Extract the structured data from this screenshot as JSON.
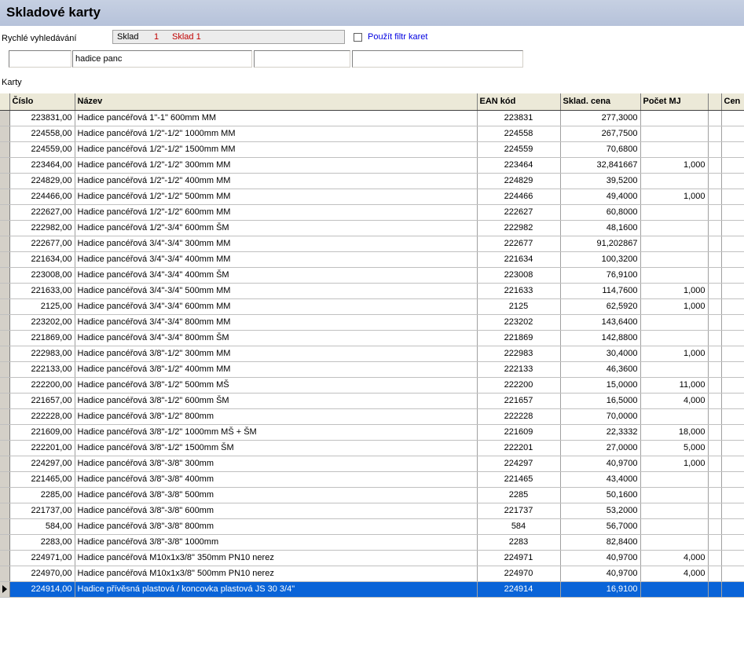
{
  "window": {
    "title": "Skladové karty"
  },
  "search": {
    "label": "Rychlé vyhledávání",
    "sklad_label": "Sklad",
    "sklad_number": "1",
    "sklad_name": "Sklad 1",
    "filter_label": "Použít filtr karet",
    "filter_checked": false,
    "field1_value": "",
    "field2_value": "hadice panc",
    "field3_value": "",
    "field4_value": ""
  },
  "grid": {
    "label": "Karty",
    "columns": [
      "Číslo",
      "Název",
      "EAN kód",
      "Sklad. cena",
      "Počet MJ",
      "",
      "Cen"
    ],
    "rows": [
      [
        "223831,00",
        "Hadice pancéřová 1\"-1\"  600mm MM",
        "223831",
        "277,3000",
        ""
      ],
      [
        "224558,00",
        "Hadice pancéřová 1/2\"-1/2\"  1000mm MM",
        "224558",
        "267,7500",
        ""
      ],
      [
        "224559,00",
        "Hadice pancéřová 1/2\"-1/2\"  1500mm MM",
        "224559",
        "70,6800",
        ""
      ],
      [
        "223464,00",
        "Hadice pancéřová 1/2\"-1/2\"  300mm MM",
        "223464",
        "32,841667",
        "1,000"
      ],
      [
        "224829,00",
        "Hadice pancéřová 1/2\"-1/2\"  400mm MM",
        "224829",
        "39,5200",
        ""
      ],
      [
        "224466,00",
        "Hadice pancéřová 1/2\"-1/2\"  500mm MM",
        "224466",
        "49,4000",
        "1,000"
      ],
      [
        "222627,00",
        "Hadice pancéřová 1/2\"-1/2\"  600mm MM",
        "222627",
        "60,8000",
        ""
      ],
      [
        "222982,00",
        "Hadice pancéřová 1/2\"-3/4\"  600mm ŠM",
        "222982",
        "48,1600",
        ""
      ],
      [
        "222677,00",
        "Hadice pancéřová 3/4\"-3/4\"  300mm MM",
        "222677",
        "91,202867",
        ""
      ],
      [
        "221634,00",
        "Hadice pancéřová 3/4\"-3/4\"  400mm MM",
        "221634",
        "100,3200",
        ""
      ],
      [
        "223008,00",
        "Hadice pancéřová 3/4\"-3/4\"  400mm ŠM",
        "223008",
        "76,9100",
        ""
      ],
      [
        "221633,00",
        "Hadice pancéřová 3/4\"-3/4\"  500mm MM",
        "221633",
        "114,7600",
        "1,000"
      ],
      [
        "2125,00",
        "Hadice pancéřová 3/4\"-3/4\"  600mm MM",
        "2125",
        "62,5920",
        "1,000"
      ],
      [
        "223202,00",
        "Hadice pancéřová 3/4\"-3/4\"  800mm MM",
        "223202",
        "143,6400",
        ""
      ],
      [
        "221869,00",
        "Hadice pancéřová 3/4\"-3/4\"  800mm ŠM",
        "221869",
        "142,8800",
        ""
      ],
      [
        "222983,00",
        "Hadice pancéřová 3/8\"-1/2\"  300mm MM",
        "222983",
        "30,4000",
        "1,000"
      ],
      [
        "222133,00",
        "Hadice pancéřová 3/8\"-1/2\"  400mm MM",
        "222133",
        "46,3600",
        ""
      ],
      [
        "222200,00",
        "Hadice pancéřová 3/8\"-1/2\"  500mm MŠ",
        "222200",
        "15,0000",
        "11,000"
      ],
      [
        "221657,00",
        "Hadice pancéřová 3/8\"-1/2\"  600mm ŠM",
        "221657",
        "16,5000",
        "4,000"
      ],
      [
        "222228,00",
        "Hadice pancéřová 3/8\"-1/2\"  800mm",
        "222228",
        "70,0000",
        ""
      ],
      [
        "221609,00",
        "Hadice pancéřová 3/8\"-1/2\" 1000mm MŠ + ŠM",
        "221609",
        "22,3332",
        "18,000"
      ],
      [
        "222201,00",
        "Hadice pancéřová 3/8\"-1/2\" 1500mm ŠM",
        "222201",
        "27,0000",
        "5,000"
      ],
      [
        "224297,00",
        "Hadice pancéřová 3/8\"-3/8\"  300mm",
        "224297",
        "40,9700",
        "1,000"
      ],
      [
        "221465,00",
        "Hadice pancéřová 3/8\"-3/8\"  400mm",
        "221465",
        "43,4000",
        ""
      ],
      [
        "2285,00",
        "Hadice pancéřová 3/8\"-3/8\"  500mm",
        "2285",
        "50,1600",
        ""
      ],
      [
        "221737,00",
        "Hadice pancéřová 3/8\"-3/8\"  600mm",
        "221737",
        "53,2000",
        ""
      ],
      [
        "584,00",
        "Hadice pancéřová 3/8\"-3/8\"  800mm",
        "584",
        "56,7000",
        ""
      ],
      [
        "2283,00",
        "Hadice pancéřová 3/8\"-3/8\" 1000mm",
        "2283",
        "82,8400",
        ""
      ],
      [
        "224971,00",
        "Hadice pancéřová M10x1x3/8\"  350mm PN10 nerez",
        "224971",
        "40,9700",
        "4,000"
      ],
      [
        "224970,00",
        "Hadice pancéřová M10x1x3/8\"  500mm PN10 nerez",
        "224970",
        "40,9700",
        "4,000"
      ],
      [
        "224914,00",
        "Hadice přívěsná plastová / koncovka plastová JS 30 3/4\"",
        "224914",
        "16,9100",
        ""
      ]
    ],
    "selected_row": 30
  },
  "colors": {
    "title_bg": "#bcc8de",
    "selection": "#0a64d8",
    "accent_red": "#c00000",
    "link_blue": "#0000e0"
  }
}
